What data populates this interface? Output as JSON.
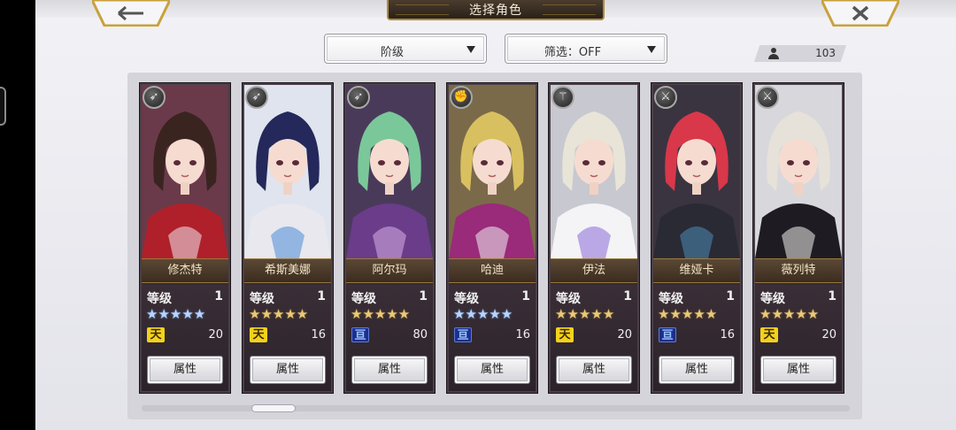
{
  "header": {
    "title": "选择角色",
    "back_icon": "←",
    "close_icon": "✕"
  },
  "filters": {
    "sort_label": "阶级",
    "filter_label": "筛选：OFF"
  },
  "character_count": "103",
  "attribute_button_label": "属性",
  "level_label": "等级",
  "characters": [
    {
      "name": "修杰特",
      "level": "1",
      "stars": "★★★★★",
      "star_color": "blue",
      "tier": "天",
      "tier_type": "heaven",
      "tier_value": "20",
      "type_icon": "bow-icon",
      "colors": {
        "bg": "#6a3a4a",
        "hair": "#3a2420",
        "outfit": "#b0202a",
        "accent": "#f0e8f0"
      }
    },
    {
      "name": "希斯美娜",
      "level": "1",
      "stars": "★★★★★",
      "star_color": "gold",
      "tier": "天",
      "tier_type": "heaven",
      "tier_value": "16",
      "type_icon": "bow-icon",
      "colors": {
        "bg": "#dfe4ee",
        "hair": "#24285a",
        "outfit": "#e8e8ee",
        "accent": "#4a8ad8"
      }
    },
    {
      "name": "阿尔玛",
      "level": "1",
      "stars": "★★★★★",
      "star_color": "gold",
      "tier": "亘",
      "tier_type": "sky",
      "tier_value": "80",
      "type_icon": "bow-icon",
      "colors": {
        "bg": "#4a3a5a",
        "hair": "#7ac89a",
        "outfit": "#6a3c8a",
        "accent": "#d8b0e8"
      }
    },
    {
      "name": "哈迪",
      "level": "1",
      "stars": "★★★★★",
      "star_color": "blue",
      "tier": "亘",
      "tier_type": "sky",
      "tier_value": "16",
      "type_icon": "fist-icon",
      "colors": {
        "bg": "#7a6a4a",
        "hair": "#d8c060",
        "outfit": "#9a2a7a",
        "accent": "#f0f0f0"
      }
    },
    {
      "name": "伊法",
      "level": "1",
      "stars": "★★★★★",
      "star_color": "gold",
      "tier": "天",
      "tier_type": "heaven",
      "tier_value": "20",
      "type_icon": "staff-icon",
      "colors": {
        "bg": "#c8c8d0",
        "hair": "#e8e4d8",
        "outfit": "#f4f4f6",
        "accent": "#8a6ad8"
      }
    },
    {
      "name": "维娅卡",
      "level": "1",
      "stars": "★★★★★",
      "star_color": "gold",
      "tier": "亘",
      "tier_type": "sky",
      "tier_value": "16",
      "type_icon": "sword-icon",
      "colors": {
        "bg": "#3a3440",
        "hair": "#d8384a",
        "outfit": "#2a2a34",
        "accent": "#4a8ab8"
      }
    },
    {
      "name": "薇列特",
      "level": "1",
      "stars": "★★★★★",
      "star_color": "gold",
      "tier": "天",
      "tier_type": "heaven",
      "tier_value": "20",
      "type_icon": "sword-icon",
      "colors": {
        "bg": "#d8d8dc",
        "hair": "#e6e2da",
        "outfit": "#1e1c22",
        "accent": "#f4f0ec"
      }
    }
  ]
}
